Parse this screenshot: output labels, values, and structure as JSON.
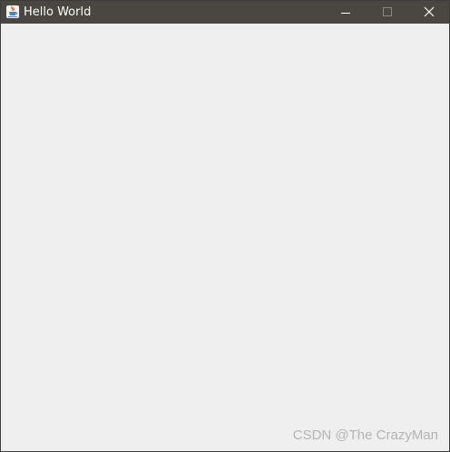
{
  "window": {
    "title": "Hello World",
    "app_icon": "java-cup-icon",
    "controls": {
      "minimize_icon": "minimize-icon",
      "maximize_icon": "maximize-icon",
      "close_icon": "close-icon"
    }
  },
  "watermark": {
    "text": "CSDN @The CrazyMan"
  },
  "colors": {
    "titlebar": "#4a4742",
    "client_background": "#efefef",
    "title_text": "#ffffff",
    "watermark": "#b4b4b4"
  }
}
